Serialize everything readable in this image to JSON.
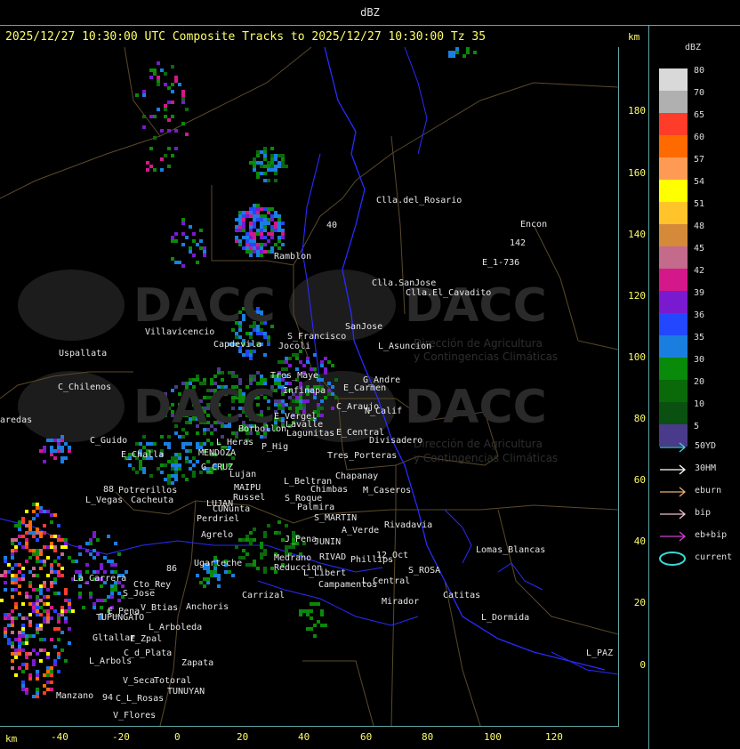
{
  "window_title": "dBZ",
  "header": {
    "text": "2025/12/27 10:30:00 UTC Composite Tracks to 2025/12/27 10:30:00 Tz 35",
    "km_top": "km",
    "km_bottom": "km"
  },
  "legend": {
    "title": "dBZ",
    "entries": [
      {
        "value": "80",
        "color": "#d9d9d9"
      },
      {
        "value": "70",
        "color": "#b0b0b0"
      },
      {
        "value": "65",
        "color": "#ff3b2a"
      },
      {
        "value": "60",
        "color": "#ff6a00"
      },
      {
        "value": "57",
        "color": "#ff9a55"
      },
      {
        "value": "54",
        "color": "#ffff00"
      },
      {
        "value": "51",
        "color": "#ffc42a"
      },
      {
        "value": "48",
        "color": "#d58a3a"
      },
      {
        "value": "45",
        "color": "#c46a8a"
      },
      {
        "value": "42",
        "color": "#d4188a"
      },
      {
        "value": "39",
        "color": "#7a1ad0"
      },
      {
        "value": "36",
        "color": "#2247ff"
      },
      {
        "value": "35",
        "color": "#1a7ee0"
      },
      {
        "value": "30",
        "color": "#0a8a0a"
      },
      {
        "value": "20",
        "color": "#0a6a0a"
      },
      {
        "value": "10",
        "color": "#0a5010"
      },
      {
        "value": "5",
        "color": "#4a3a8a"
      }
    ]
  },
  "tracks": [
    {
      "label": "50YD",
      "color": "#3ad6d6"
    },
    {
      "label": "30HM",
      "color": "#ffffff"
    },
    {
      "label": "eburn",
      "color": "#e8b070"
    },
    {
      "label": "bip",
      "color": "#f0c0d0"
    },
    {
      "label": "eb+bip",
      "color": "#d040d0"
    },
    {
      "label": "current",
      "color": "#3ad6d6"
    }
  ],
  "y_ticks": [
    "180",
    "160",
    "140",
    "120",
    "100",
    "80",
    "60",
    "40",
    "20",
    "0"
  ],
  "x_ticks": [
    "-40",
    "-20",
    "0",
    "20",
    "40",
    "60",
    "80",
    "100",
    "120"
  ],
  "places": [
    {
      "name": "Clla.del_Rosario"
    },
    {
      "name": "Encon"
    },
    {
      "name": "142"
    },
    {
      "name": "E_1-736"
    },
    {
      "name": "Ramblon"
    },
    {
      "name": "Clla.SanJose"
    },
    {
      "name": "Clla.El_Cavadito"
    },
    {
      "name": "Villavicencio"
    },
    {
      "name": "Capdevila"
    },
    {
      "name": "S_Francisco"
    },
    {
      "name": "SanJose"
    },
    {
      "name": "L_Asuncion"
    },
    {
      "name": "Jocoli"
    },
    {
      "name": "Uspallata"
    },
    {
      "name": "C_Chilenos"
    },
    {
      "name": "Tres_Maye"
    },
    {
      "name": "Infinapa"
    },
    {
      "name": "E_Carmen"
    },
    {
      "name": "G_Andre"
    },
    {
      "name": "C_Araujo"
    },
    {
      "name": "N_Calif"
    },
    {
      "name": "E_Vergel"
    },
    {
      "name": "Lavalle"
    },
    {
      "name": "Borbollon"
    },
    {
      "name": "Lagunitas"
    },
    {
      "name": "E_Central"
    },
    {
      "name": "Divisadero"
    },
    {
      "name": "P_Hig"
    },
    {
      "name": "Tres_Porteras"
    },
    {
      "name": "C_Guido"
    },
    {
      "name": "L_Heras"
    },
    {
      "name": "E_Challa"
    },
    {
      "name": "MENDOZA"
    },
    {
      "name": "G_CRUZ"
    },
    {
      "name": "Lujan"
    },
    {
      "name": "L_Beltran"
    },
    {
      "name": "Chapanay"
    },
    {
      "name": "Chimbas"
    },
    {
      "name": "M_Caseros"
    },
    {
      "name": "Potrerillos"
    },
    {
      "name": "L_Vegas"
    },
    {
      "name": "Cacheuta"
    },
    {
      "name": "MAIPU"
    },
    {
      "name": "Russel"
    },
    {
      "name": "S_Roque"
    },
    {
      "name": "Palmira"
    },
    {
      "name": "LUJAN"
    },
    {
      "name": "CUNunta"
    },
    {
      "name": "S_MARTIN"
    },
    {
      "name": "Perdriel"
    },
    {
      "name": "A_Verde"
    },
    {
      "name": "Agrelo"
    },
    {
      "name": "J_Pena"
    },
    {
      "name": "JUNIN"
    },
    {
      "name": "Rivadavia"
    },
    {
      "name": "Lomas_Blancas"
    },
    {
      "name": "Ugarteche"
    },
    {
      "name": "Medrano"
    },
    {
      "name": "Reduccion"
    },
    {
      "name": "RIVAD"
    },
    {
      "name": "Phillips"
    },
    {
      "name": "12_Oct"
    },
    {
      "name": "S_ROSA"
    },
    {
      "name": "L_Libert"
    },
    {
      "name": "Campamentos"
    },
    {
      "name": "L_Central"
    },
    {
      "name": "La_Carrera"
    },
    {
      "name": "Cto_Rey"
    },
    {
      "name": "S_Jose"
    },
    {
      "name": "Catitas"
    },
    {
      "name": "Carrizal"
    },
    {
      "name": "Anchoris"
    },
    {
      "name": "Mirador"
    },
    {
      "name": "E_Pena"
    },
    {
      "name": "V_Btias"
    },
    {
      "name": "TUPUNGATO"
    },
    {
      "name": "L_Dormida"
    },
    {
      "name": "L_Arboleda"
    },
    {
      "name": "Gltallar"
    },
    {
      "name": "E_Zpal"
    },
    {
      "name": "C_d_Plata"
    },
    {
      "name": "L_Arbols"
    },
    {
      "name": "Zapata"
    },
    {
      "name": "L_PAZ"
    },
    {
      "name": "V_Seca"
    },
    {
      "name": "Totoral"
    },
    {
      "name": "TUNUYAN"
    },
    {
      "name": "Manzano"
    },
    {
      "name": "C_L_Rosas"
    },
    {
      "name": "V_Flores"
    },
    {
      "name": "aredas"
    },
    {
      "name": "88"
    },
    {
      "name": "86"
    },
    {
      "name": "94"
    },
    {
      "name": "40"
    }
  ],
  "watermark": {
    "brand": "DACC",
    "line1": "Dirección de Agricultura",
    "line2": "y Contingencias Climáticas"
  }
}
